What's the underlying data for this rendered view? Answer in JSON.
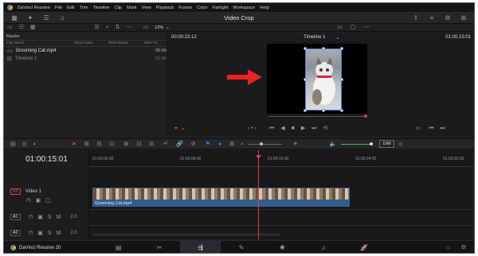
{
  "menu": [
    "DaVinci Resolve",
    "File",
    "Edit",
    "Trim",
    "Timeline",
    "Clip",
    "Mark",
    "View",
    "Playback",
    "Fusion",
    "Color",
    "Fairlight",
    "Workspace",
    "Help"
  ],
  "window_title": "Video Crop",
  "zoom": "12%",
  "media_pool": {
    "title": "Master",
    "columns": [
      "Clip Name",
      "Cloud Sync",
      "Reel Name",
      "Start TC"
    ],
    "clips": [
      {
        "name": "Grooming Cat.mp4",
        "tc": "00:00"
      },
      {
        "name": "Timeline 1",
        "tc": "01:00"
      }
    ]
  },
  "viewer": {
    "source_tc": "00:00:23:12",
    "timeline_name": "Timeline 1",
    "record_tc": "01:00:15:01"
  },
  "timeline": {
    "timecode": "01:00:15:01",
    "ruler": [
      "01:00:00:00",
      "01:00:08:00",
      "01:00:16:00",
      "01:00:24:00",
      "01:00:32:00"
    ],
    "tracks": [
      {
        "tag": "V1",
        "name": "Video 1"
      },
      {
        "tag": "A1",
        "level": "2.0"
      },
      {
        "tag": "A2",
        "level": "2.0"
      }
    ],
    "clip_name": "Grooming Cat.mp4",
    "dim_label": "DIM"
  },
  "footer": {
    "app_label": "DaVinci Resolve 20"
  },
  "colors": {
    "accent": "#e23b3b",
    "clip_blue": "#2f5f8f",
    "selection": "#5a7fd0"
  }
}
